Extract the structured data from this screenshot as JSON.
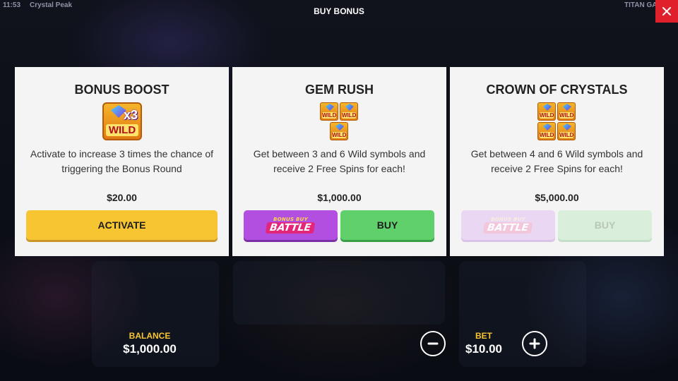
{
  "status_bar": {
    "time": "11:53",
    "game_name": "Crystal Peak",
    "brand": "TITAN GA"
  },
  "screen_title": "BUY BONUS",
  "close_icon": "close-icon",
  "cards": [
    {
      "title": "BONUS BOOST",
      "icon": "x3-wild-icon",
      "icon_text": "x3",
      "icon_wild": "WILD",
      "description": "Activate to increase 3 times the chance of triggering the Bonus Round",
      "price": "$20.00",
      "button_label": "ACTIVATE"
    },
    {
      "title": "GEM RUSH",
      "icon": "three-wilds-icon",
      "icon_wild": "WILD",
      "description": "Get between 3 and 6 Wild symbols and receive 2 Free Spins for each!",
      "price": "$1,000.00",
      "battle_small": "BONUS BUY",
      "battle_big": "BATTLE",
      "button_label": "BUY"
    },
    {
      "title": "CROWN OF CRYSTALS",
      "icon": "four-wilds-icon",
      "icon_wild": "WILD",
      "description": "Get between 4 and 6 Wild symbols and receive 2 Free Spins for each!",
      "price": "$5,000.00",
      "battle_small": "BONUS BUY",
      "battle_big": "BATTLE",
      "button_label": "BUY"
    }
  ],
  "balance": {
    "label": "BALANCE",
    "value": "$1,000.00"
  },
  "bet": {
    "label": "BET",
    "value": "$10.00"
  },
  "colors": {
    "activate": "#f7c531",
    "battle": "#b24fe0",
    "buy": "#5fd06a",
    "close": "#e0202a",
    "label_accent": "#f7c531"
  }
}
